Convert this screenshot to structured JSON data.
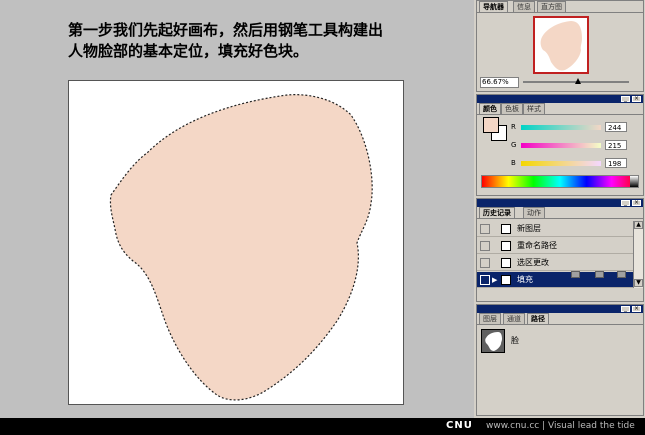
{
  "instruction": {
    "line1": "第一步我们先起好画布，然后用钢笔工具构建出",
    "line2": "人物脸部的基本定位，填充好色块。"
  },
  "colors": {
    "face_fill": "#f4d7c6",
    "titlebar": "#0a246a",
    "panel_bg": "#d4d0c8",
    "selection": "#0a246a"
  },
  "navigator": {
    "tabs": [
      "导航器",
      "信息",
      "直方图"
    ],
    "zoom": "66.67%",
    "zoom_slider": 0.62
  },
  "color_panel": {
    "tabs": [
      "颜色",
      "色板",
      "样式"
    ],
    "channels": [
      {
        "label": "R",
        "value": "244"
      },
      {
        "label": "G",
        "value": "215"
      },
      {
        "label": "B",
        "value": "198"
      }
    ]
  },
  "history": {
    "tabs": [
      "历史记录",
      "动作"
    ],
    "items": [
      "新图层",
      "重命名路径",
      "选区更改",
      "填充"
    ],
    "active_index": 3
  },
  "paths": {
    "tabs": [
      "图层",
      "通道",
      "路径"
    ],
    "items": [
      "脸"
    ]
  },
  "footer": {
    "brand": "CNU",
    "tagline": "www.cnu.cc | Visual lead the tide"
  }
}
